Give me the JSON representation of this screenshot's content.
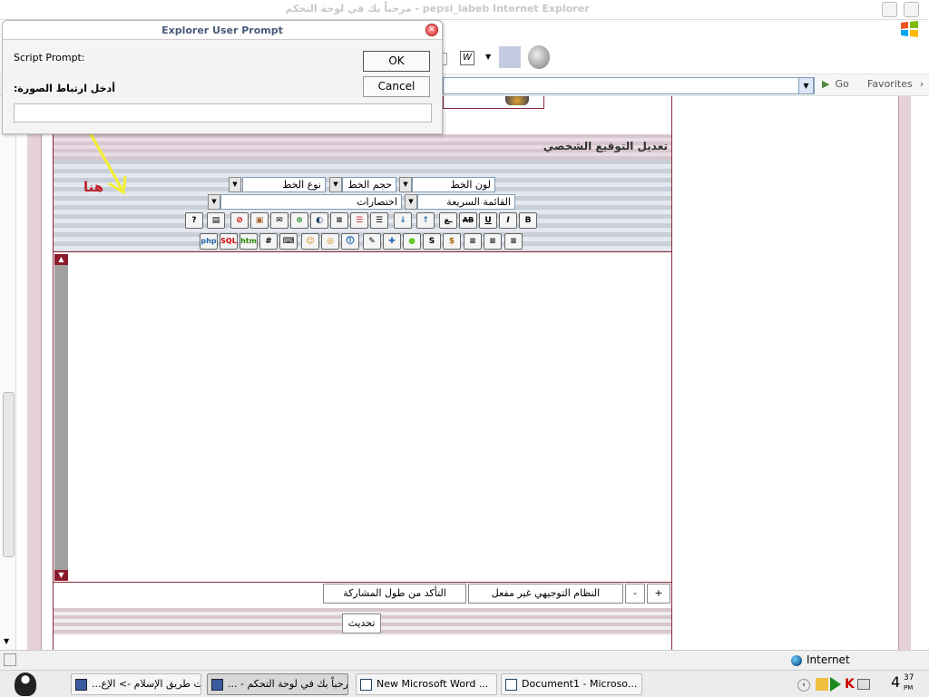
{
  "browser": {
    "title": "مرحباً بك في لوحة التحكم - pepsi_labeb Internet Explorer",
    "go_label": "Go",
    "favorites_label": "Favorites",
    "status_zone": "Internet"
  },
  "dialog": {
    "title": "Explorer User Prompt",
    "script_prompt_label": "Script Prompt:",
    "prompt_text": "أدخل ارتباط الصورة:",
    "input_value": "",
    "ok_label": "OK",
    "cancel_label": "Cancel"
  },
  "page": {
    "header_title": "تعديل التوقيع الشخصي",
    "here_label": "هنا",
    "font_color_select": "لون الخط",
    "font_size_select": "حجم الخط",
    "font_type_select": "نوع الخط",
    "quick_list_select": "القائمة السريعة",
    "shortcuts_select": "اختصارات",
    "toolbar_row1": [
      "B",
      "I",
      "U",
      "AB",
      "ـع",
      "↑",
      "↓",
      "☰",
      "☰",
      "≡",
      "◐",
      "⊕",
      "✉",
      "▣",
      "⊘",
      "▤",
      "?"
    ],
    "toolbar_row2": [
      "≡",
      "≡",
      "≡",
      "$",
      "S",
      "●",
      "✚",
      "✎",
      "⓵",
      "◎",
      "☺",
      "⌨",
      "#",
      "htm",
      "SQL",
      "php"
    ],
    "guidance_system_button": "النظام التوجيهي غير مفعل",
    "check_length_button": "التأكد من طول المشاركة",
    "plus_button": "+",
    "minus_button": "-",
    "update_button": "تحديث"
  },
  "taskbar": {
    "items": [
      "...أدوات طريق الإسلام -> الإع",
      "... - مرحباً بك في لوحة التحكم",
      "New Microsoft Word ...",
      "Document1 - Microso..."
    ],
    "clock_hour": "4",
    "clock_min": "37",
    "clock_ampm": "PM"
  }
}
